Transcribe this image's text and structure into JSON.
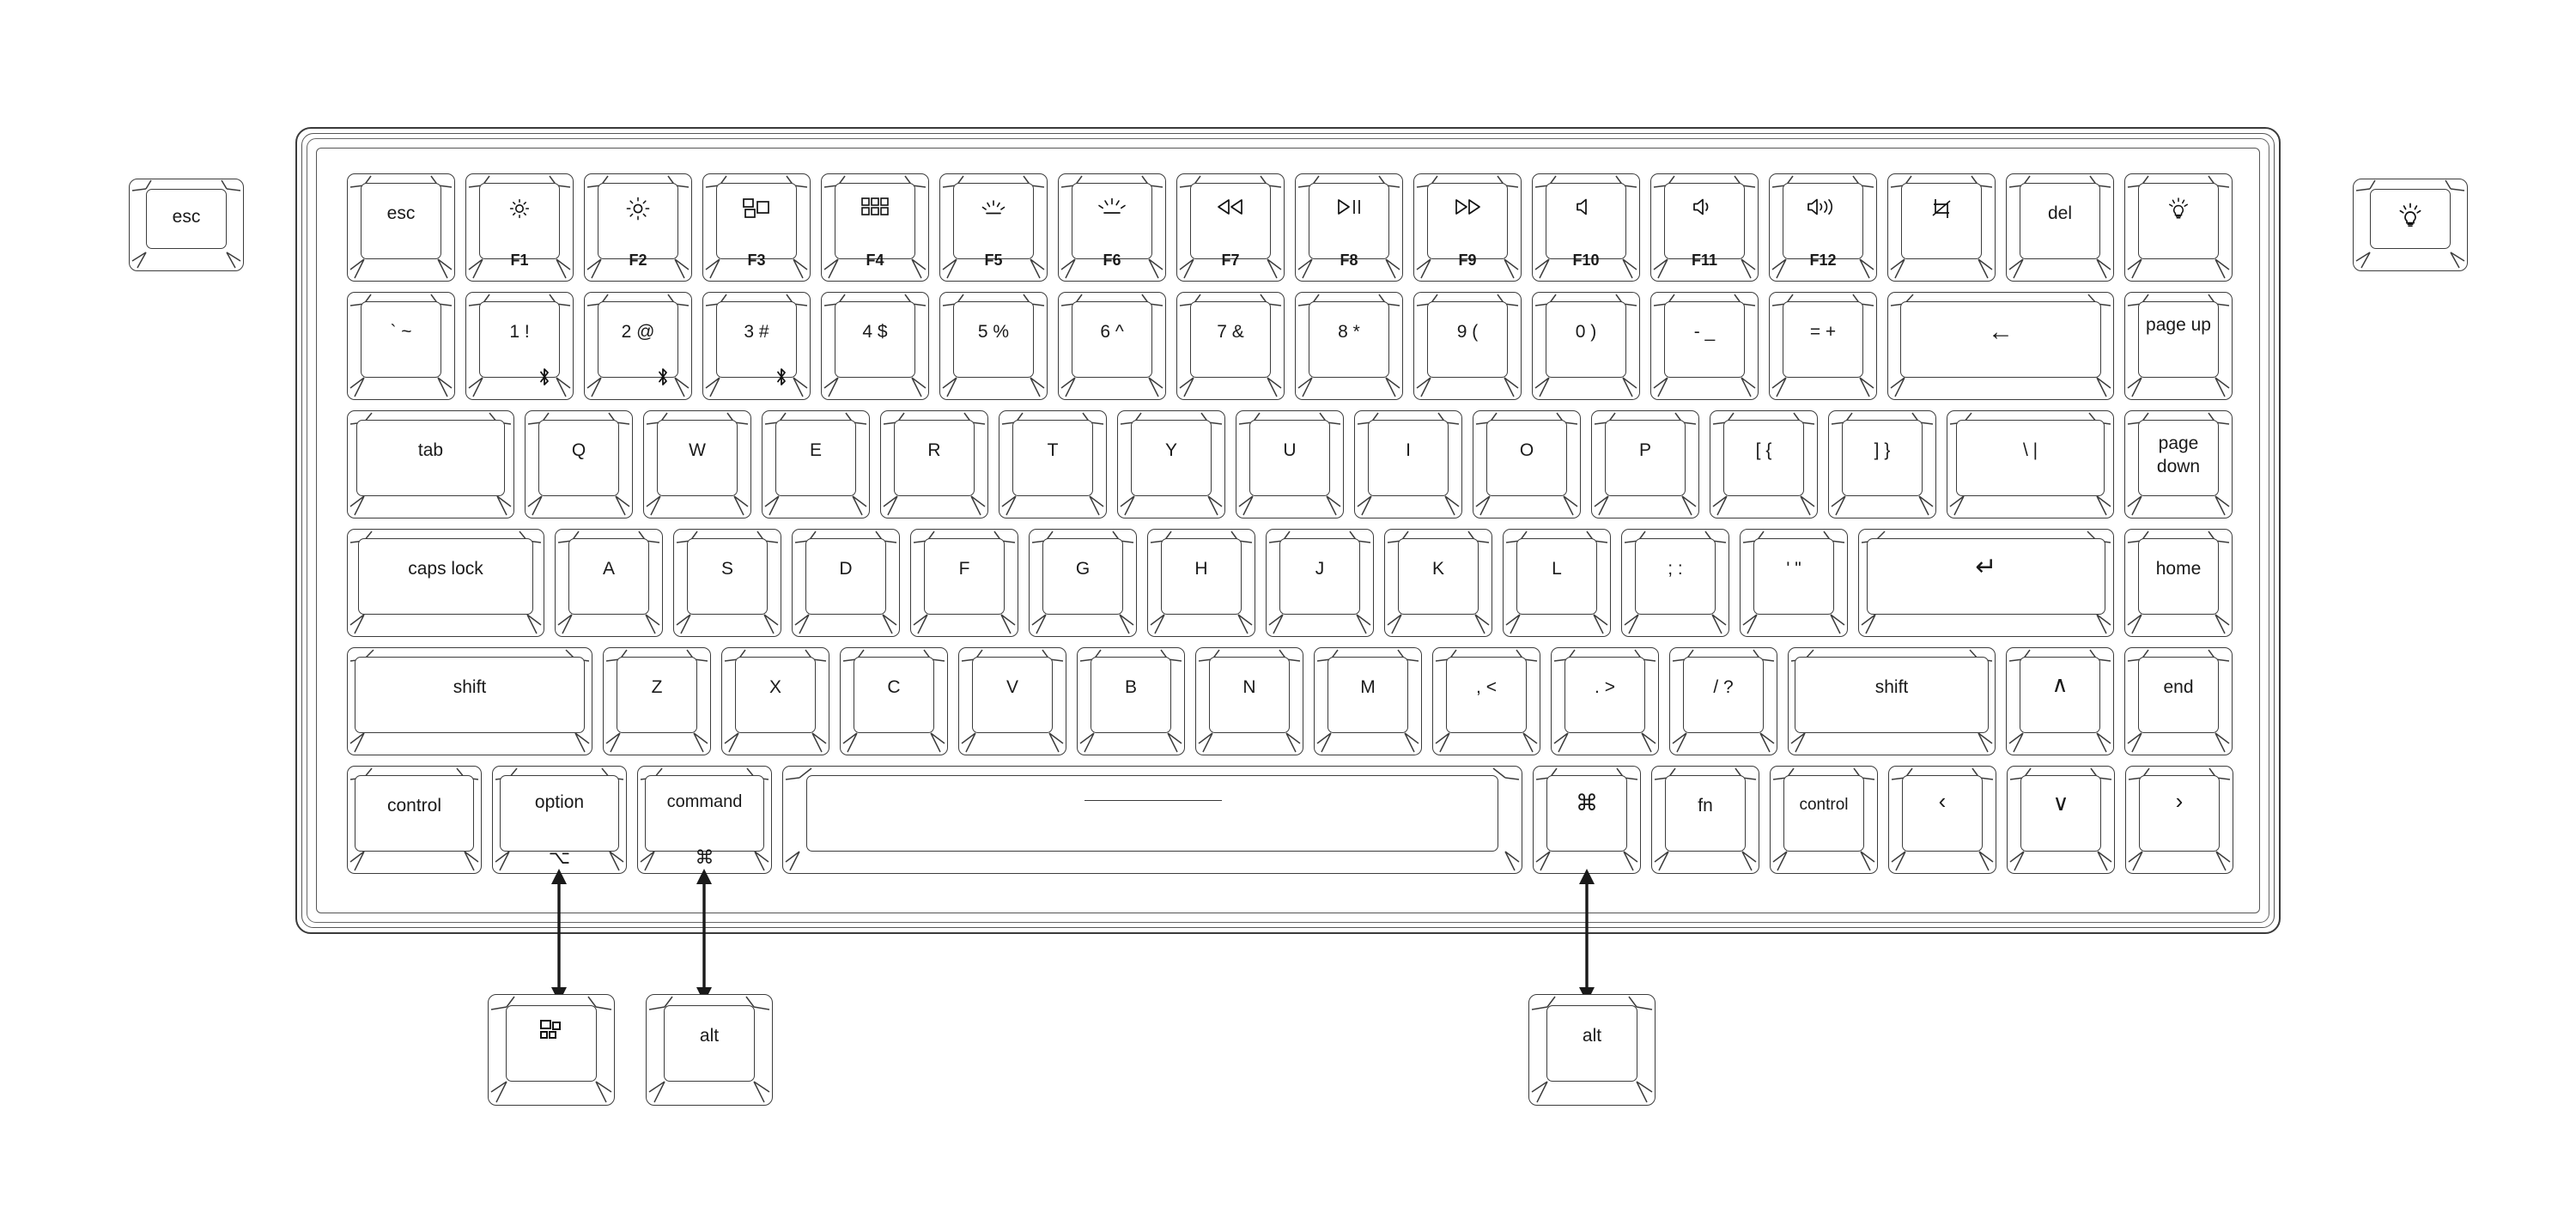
{
  "diagram": {
    "title": "Keychron keyboard layout diagram",
    "type": "keyboard-layout",
    "line_color": "#3c3c3c",
    "background": "#ffffff"
  },
  "standalone_left": {
    "label": "esc",
    "name": "esc-keycap"
  },
  "standalone_right": {
    "label": "",
    "icon": "backlight-bulb-icon",
    "name": "backlight-keycap"
  },
  "alt_caps": [
    {
      "label": "",
      "icon": "windows-start-icon",
      "name": "windows-keycap"
    },
    {
      "label": "alt",
      "icon": "",
      "name": "alt-keycap-left"
    },
    {
      "label": "alt",
      "icon": "",
      "name": "alt-keycap-right"
    }
  ],
  "rows": [
    {
      "name": "function-row",
      "keys": [
        {
          "label": "esc",
          "fn": "",
          "glyph": "",
          "icon": ""
        },
        {
          "label": "",
          "fn": "F1",
          "glyph": "brightness-down-icon",
          "icon": "sun-small"
        },
        {
          "label": "",
          "fn": "F2",
          "glyph": "brightness-up-icon",
          "icon": "sun-large"
        },
        {
          "label": "",
          "fn": "F3",
          "glyph": "mission-control-icon",
          "icon": "panes"
        },
        {
          "label": "",
          "fn": "F4",
          "glyph": "launchpad-icon",
          "icon": "grid6"
        },
        {
          "label": "",
          "fn": "F5",
          "glyph": "backlight-down-icon",
          "icon": "rays-small"
        },
        {
          "label": "",
          "fn": "F6",
          "glyph": "backlight-up-icon",
          "icon": "rays-large"
        },
        {
          "label": "",
          "fn": "F7",
          "glyph": "rewind-icon",
          "icon": "prev"
        },
        {
          "label": "",
          "fn": "F8",
          "glyph": "play-pause-icon",
          "icon": "playpause"
        },
        {
          "label": "",
          "fn": "F9",
          "glyph": "fast-forward-icon",
          "icon": "next"
        },
        {
          "label": "",
          "fn": "F10",
          "glyph": "volume-mute-icon",
          "icon": "vol0"
        },
        {
          "label": "",
          "fn": "F11",
          "glyph": "volume-down-icon",
          "icon": "vol1"
        },
        {
          "label": "",
          "fn": "F12",
          "glyph": "volume-up-icon",
          "icon": "vol2"
        },
        {
          "label": "",
          "fn": "",
          "glyph": "screenshot-icon",
          "icon": "snip"
        },
        {
          "label": "del",
          "fn": "",
          "glyph": "",
          "icon": ""
        },
        {
          "label": "",
          "fn": "",
          "glyph": "backlight-bulb-icon",
          "icon": "bulb"
        }
      ]
    },
    {
      "name": "number-row",
      "keys": [
        {
          "label": "` ~"
        },
        {
          "label": "1 !",
          "bluetooth": true
        },
        {
          "label": "2 @",
          "bluetooth": true
        },
        {
          "label": "3 #",
          "bluetooth": true
        },
        {
          "label": "4 $"
        },
        {
          "label": "5 %"
        },
        {
          "label": "6 ^"
        },
        {
          "label": "7 &"
        },
        {
          "label": "8 *"
        },
        {
          "label": "9 ("
        },
        {
          "label": "0 )"
        },
        {
          "label": "- _"
        },
        {
          "label": "= +"
        },
        {
          "label": "",
          "glyph": "backspace-arrow-icon"
        },
        {
          "label": "page up",
          "two_line": true
        }
      ]
    },
    {
      "name": "tab-row",
      "keys": [
        {
          "label": "tab"
        },
        {
          "label": "Q"
        },
        {
          "label": "W"
        },
        {
          "label": "E"
        },
        {
          "label": "R"
        },
        {
          "label": "T"
        },
        {
          "label": "Y"
        },
        {
          "label": "U"
        },
        {
          "label": "I"
        },
        {
          "label": "O"
        },
        {
          "label": "P"
        },
        {
          "label": "[ {"
        },
        {
          "label": "] }"
        },
        {
          "label": "\\ |"
        },
        {
          "label": "page down",
          "two_line": true
        }
      ]
    },
    {
      "name": "home-row",
      "keys": [
        {
          "label": "caps lock"
        },
        {
          "label": "A"
        },
        {
          "label": "S"
        },
        {
          "label": "D"
        },
        {
          "label": "F"
        },
        {
          "label": "G"
        },
        {
          "label": "H"
        },
        {
          "label": "J"
        },
        {
          "label": "K"
        },
        {
          "label": "L"
        },
        {
          "label": "; :"
        },
        {
          "label": "' \""
        },
        {
          "label": "",
          "glyph": "enter-arrow-icon"
        },
        {
          "label": "home"
        }
      ]
    },
    {
      "name": "shift-row",
      "keys": [
        {
          "label": "shift"
        },
        {
          "label": "Z"
        },
        {
          "label": "X"
        },
        {
          "label": "C"
        },
        {
          "label": "V"
        },
        {
          "label": "B"
        },
        {
          "label": "N"
        },
        {
          "label": "M"
        },
        {
          "label": ", <"
        },
        {
          "label": ". >"
        },
        {
          "label": "/ ?"
        },
        {
          "label": "shift"
        },
        {
          "label": "",
          "glyph": "arrow-up-icon"
        },
        {
          "label": "end"
        }
      ]
    },
    {
      "name": "modifier-row",
      "keys": [
        {
          "label": "control"
        },
        {
          "label": "option",
          "sub": "⌥"
        },
        {
          "label": "command",
          "sub": "⌘"
        },
        {
          "label": "",
          "name": "spacebar"
        },
        {
          "label": "",
          "sub_only": "⌘",
          "name": "command-right"
        },
        {
          "label": "fn"
        },
        {
          "label": "control"
        },
        {
          "label": "",
          "glyph": "arrow-left-icon"
        },
        {
          "label": "",
          "glyph": "arrow-down-icon"
        },
        {
          "label": "",
          "glyph": "arrow-right-icon"
        }
      ]
    }
  ]
}
